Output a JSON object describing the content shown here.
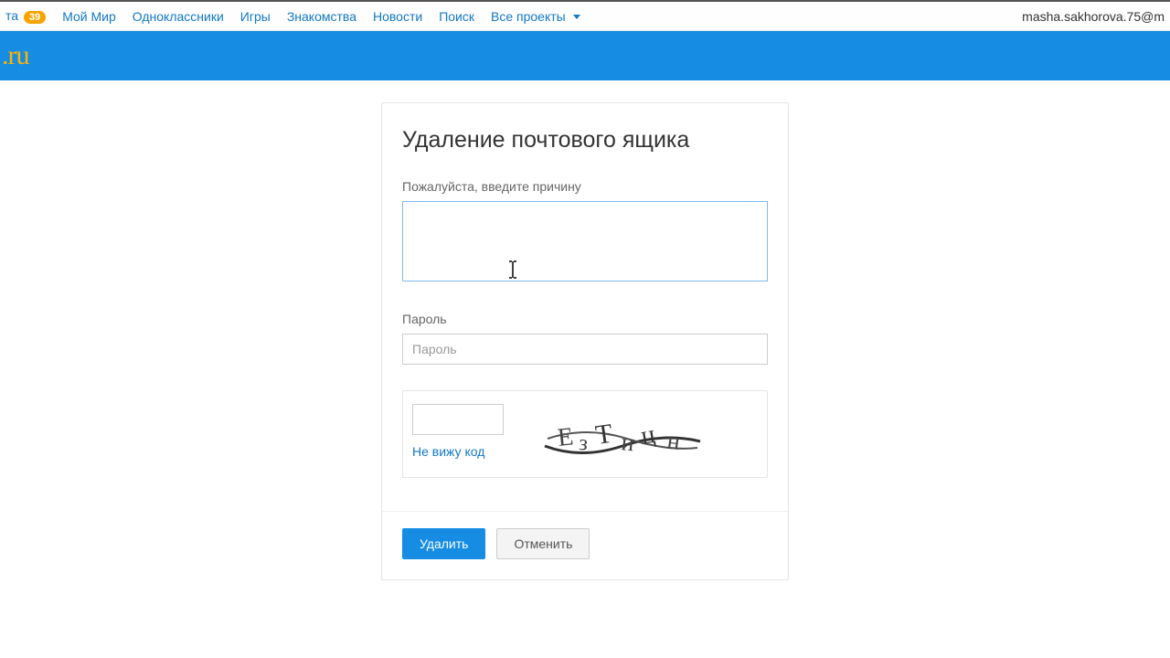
{
  "topbar": {
    "items": [
      {
        "label": "та",
        "badge": "39"
      },
      {
        "label": "Мой Мир"
      },
      {
        "label": "Одноклассники"
      },
      {
        "label": "Игры"
      },
      {
        "label": "Знакомства"
      },
      {
        "label": "Новости"
      },
      {
        "label": "Поиск"
      },
      {
        "label": "Все проекты",
        "dropdown": true
      }
    ],
    "user_email": "masha.sakhorova.75@m"
  },
  "header": {
    "logo_text": ".ru"
  },
  "form": {
    "title": "Удаление почтового ящика",
    "reason_label": "Пожалуйста, введите причину",
    "reason_value": "",
    "password_label": "Пароль",
    "password_placeholder": "Пароль",
    "password_value": "",
    "captcha": {
      "input_value": "",
      "reload_label": "Не вижу код",
      "image_text": "ЕзТицн"
    },
    "submit_label": "Удалить",
    "cancel_label": "Отменить"
  },
  "colors": {
    "brand_blue": "#168de2",
    "link_blue": "#1378c5",
    "accent_orange": "#f7a400",
    "logo_orange": "#ffb300"
  }
}
